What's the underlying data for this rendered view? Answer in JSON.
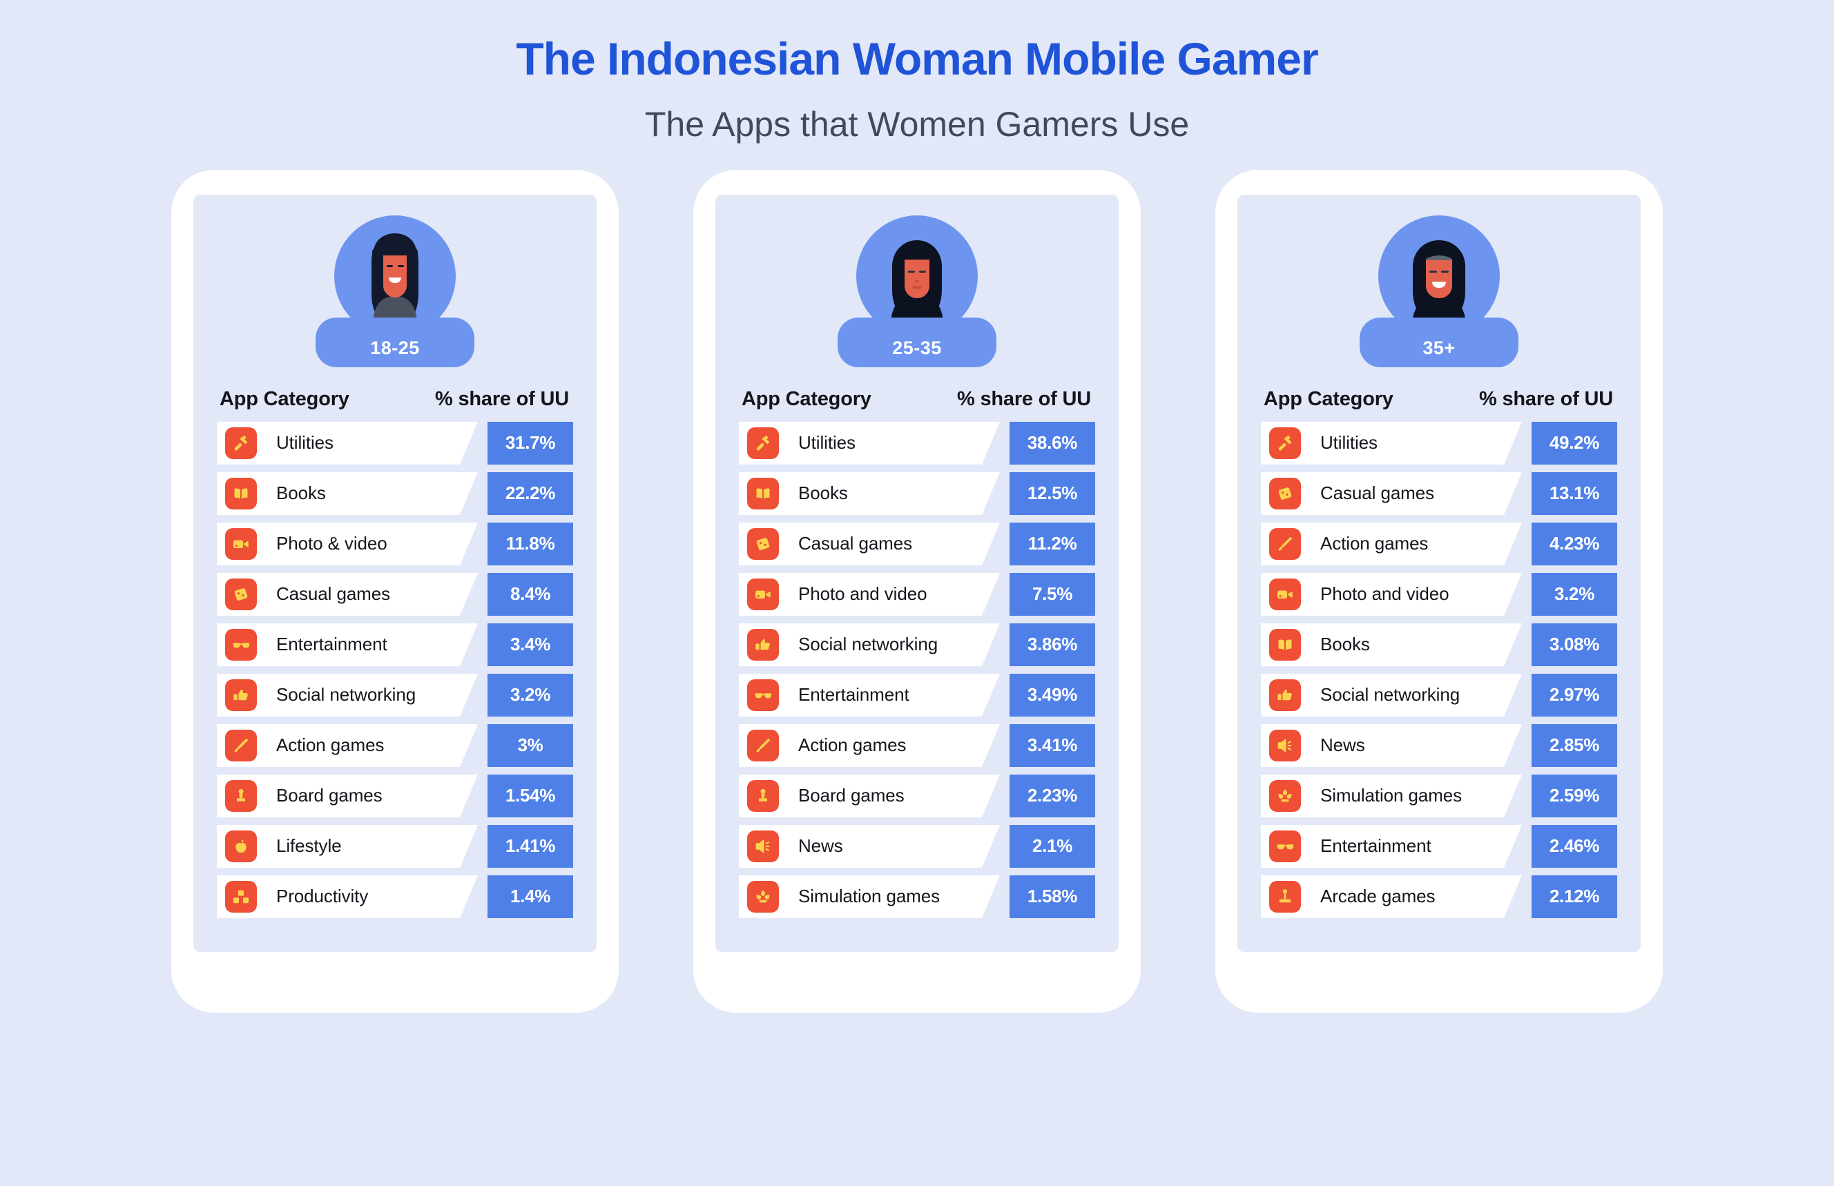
{
  "header": {
    "title": "The Indonesian Woman Mobile Gamer",
    "subtitle": "The Apps that Women Gamers Use"
  },
  "colors": {
    "background": "#e2e8f7",
    "title_blue": "#1f54d8",
    "subtitle_gray": "#3f4a5a",
    "chip_blue": "#4f80e8",
    "avatar_blue": "#6d95ef",
    "icon_red": "#ee4f35",
    "icon_yellow": "#fbd34d",
    "row_white": "#ffffff"
  },
  "columns": {
    "category_header": "App Category",
    "share_header": "% share of UU"
  },
  "chart_data": {
    "type": "bar",
    "title": "The Indonesian Woman Mobile Gamer",
    "subtitle": "The Apps that Women Gamers Use",
    "xlabel": "% share of UU",
    "ylabel": "App Category",
    "grid": false,
    "legend": "none",
    "panels": [
      {
        "age_group": "18-25",
        "avatar": "woman-long-hair-avatar",
        "categories": [
          "Utilities",
          "Books",
          "Photo & video",
          "Casual games",
          "Entertainment",
          "Social networking",
          "Action games",
          "Board games",
          "Lifestyle",
          "Productivity"
        ],
        "values": [
          31.7,
          22.2,
          11.8,
          8.4,
          3.4,
          3.2,
          3,
          1.54,
          1.41,
          1.4
        ],
        "labels": [
          "31.7%",
          "22.2%",
          "11.8%",
          "8.4%",
          "3.4%",
          "3.2%",
          "3%",
          "1.54%",
          "1.41%",
          "1.4%"
        ],
        "icons": [
          "hammer-icon",
          "book-icon",
          "video-camera-icon",
          "playing-card-icon",
          "3d-glasses-icon",
          "thumbs-up-icon",
          "sword-icon",
          "chess-pawn-icon",
          "apple-icon",
          "blocks-icon"
        ]
      },
      {
        "age_group": "25-35",
        "avatar": "woman-hijab-avatar",
        "categories": [
          "Utilities",
          "Books",
          "Casual games",
          "Photo and video",
          "Social networking",
          "Entertainment",
          "Action games",
          "Board games",
          "News",
          "Simulation games"
        ],
        "values": [
          38.6,
          12.5,
          11.2,
          7.5,
          3.86,
          3.49,
          3.41,
          2.23,
          2.1,
          1.58
        ],
        "labels": [
          "38.6%",
          "12.5%",
          "11.2%",
          "7.5%",
          "3.86%",
          "3.49%",
          "3.41%",
          "2.23%",
          "2.1%",
          "1.58%"
        ],
        "icons": [
          "hammer-icon",
          "book-icon",
          "playing-card-icon",
          "video-camera-icon",
          "thumbs-up-icon",
          "3d-glasses-icon",
          "sword-icon",
          "chess-pawn-icon",
          "megaphone-icon",
          "plant-icon"
        ]
      },
      {
        "age_group": "35+",
        "avatar": "woman-hijab-older-avatar",
        "categories": [
          "Utilities",
          "Casual games",
          "Action games",
          "Photo and video",
          "Books",
          "Social networking",
          "News",
          "Simulation games",
          "Entertainment",
          "Arcade games"
        ],
        "values": [
          49.2,
          13.1,
          4.23,
          3.2,
          3.08,
          2.97,
          2.85,
          2.59,
          2.46,
          2.12
        ],
        "labels": [
          "49.2%",
          "13.1%",
          "4.23%",
          "3.2%",
          "3.08%",
          "2.97%",
          "2.85%",
          "2.59%",
          "2.46%",
          "2.12%"
        ],
        "icons": [
          "hammer-icon",
          "playing-card-icon",
          "sword-icon",
          "video-camera-icon",
          "book-icon",
          "thumbs-up-icon",
          "megaphone-icon",
          "plant-icon",
          "3d-glasses-icon",
          "joystick-icon"
        ]
      }
    ]
  }
}
